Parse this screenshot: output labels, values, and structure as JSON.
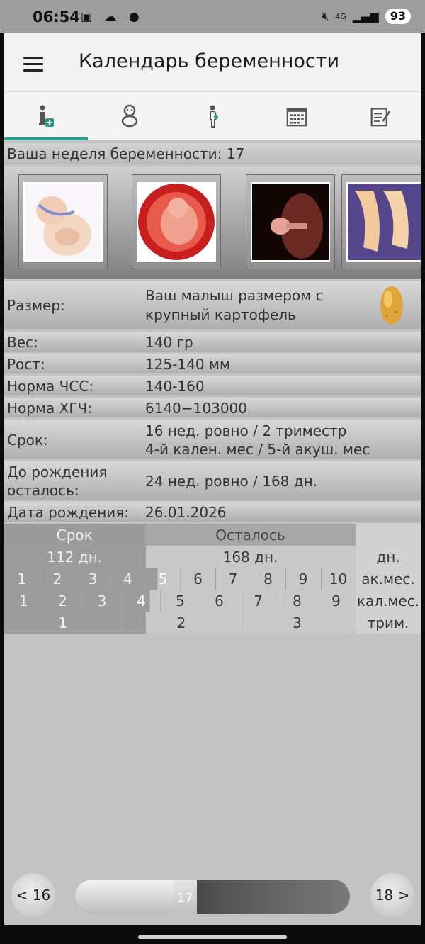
{
  "status_bar": {
    "time": "06:54",
    "signal_label": "4G",
    "battery": "93"
  },
  "app_bar": {
    "title": "Календарь беременности"
  },
  "tabs": [
    {
      "icon": "info-icon",
      "active": true
    },
    {
      "icon": "baby-icon",
      "active": false
    },
    {
      "icon": "pregnant-woman-icon",
      "active": false
    },
    {
      "icon": "calendar-icon",
      "active": false
    },
    {
      "icon": "notes-edit-icon",
      "active": false
    }
  ],
  "week": {
    "label": "Ваша неделя беременности: 17"
  },
  "info": {
    "size_label": "Размер:",
    "size_value_line1": "Ваш малыш размером с",
    "size_value_line2": "крупный картофель",
    "weight_label": "Вес:",
    "weight_value": "140 гр",
    "height_label": "Рост:",
    "height_value": "125-140 мм",
    "hr_label": "Норма ЧСС:",
    "hr_value": "140-160",
    "hcg_label": "Норма ХГЧ:",
    "hcg_value": "6140−103000",
    "term_label": "Срок:",
    "term_value_line1": "16 нед. ровно / 2 триместр",
    "term_value_line2": "4-й кален. мес / 5-й акуш. мес",
    "left_label_line1": "До рождения",
    "left_label_line2": "осталось:",
    "left_value": "24 нед. ровно / 168 дн.",
    "birth_label": "Дата рождения:",
    "birth_value": "26.01.2026"
  },
  "progress_table": {
    "header_past": "Срок",
    "header_left": "Осталось",
    "days_past": "112 дн.",
    "days_left": "168 дн.",
    "days_unit": "дн.",
    "obst_months": [
      "1",
      "2",
      "3",
      "4",
      "5",
      "6",
      "7",
      "8",
      "9",
      "10"
    ],
    "obst_unit": "ак.мес.",
    "cal_months": [
      "1",
      "2",
      "3",
      "4",
      "5",
      "6",
      "7",
      "8",
      "9"
    ],
    "cal_unit": "кал.мес.",
    "trimesters": [
      "1",
      "2",
      "3"
    ],
    "trim_unit": "трим."
  },
  "navigation": {
    "prev_label": "< 16",
    "next_label": "18 >",
    "current_week": "17",
    "week_fraction": 0.4
  },
  "colors": {
    "accent": "#22a093",
    "elapsed": "#9c9c9c",
    "remaining": "#c8c8c8"
  }
}
